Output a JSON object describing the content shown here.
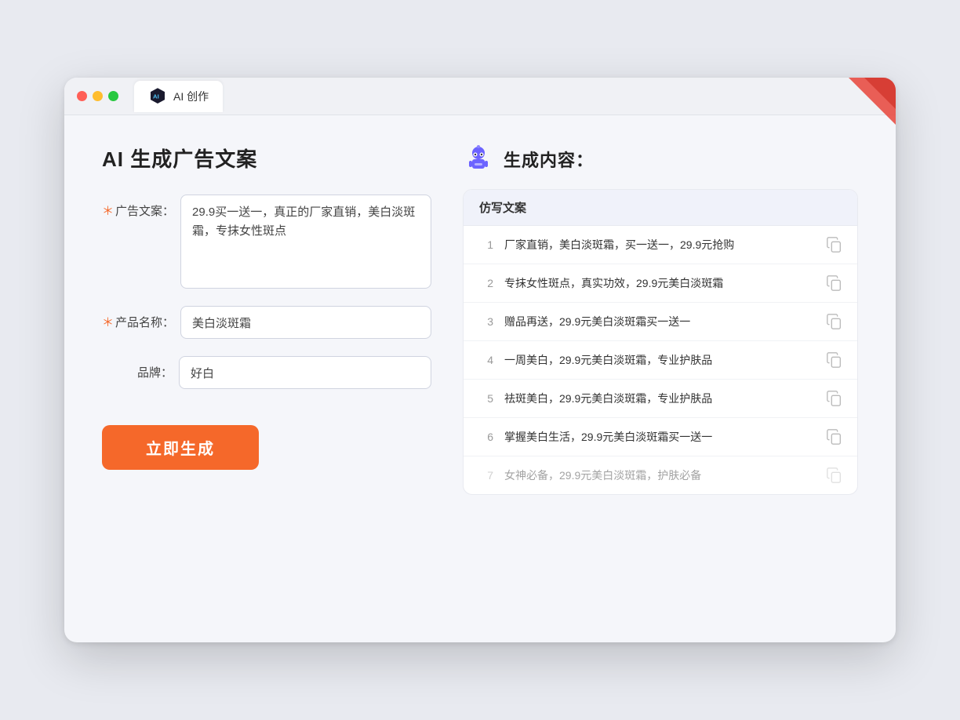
{
  "window": {
    "tab_label": "AI 创作"
  },
  "page": {
    "title": "AI 生成广告文案",
    "result_title": "生成内容："
  },
  "form": {
    "ad_copy_label": "广告文案：",
    "ad_copy_required": "＊",
    "ad_copy_value": "29.9买一送一，真正的厂家直销，美白淡斑霜，专抹女性斑点",
    "product_name_label": "产品名称：",
    "product_name_required": "＊",
    "product_name_value": "美白淡斑霜",
    "brand_label": "品牌：",
    "brand_value": "好白",
    "generate_btn_label": "立即生成"
  },
  "results": {
    "table_header": "仿写文案",
    "rows": [
      {
        "num": "1",
        "text": "厂家直销，美白淡斑霜，买一送一，29.9元抢购",
        "faded": false
      },
      {
        "num": "2",
        "text": "专抹女性斑点，真实功效，29.9元美白淡斑霜",
        "faded": false
      },
      {
        "num": "3",
        "text": "赠品再送，29.9元美白淡斑霜买一送一",
        "faded": false
      },
      {
        "num": "4",
        "text": "一周美白，29.9元美白淡斑霜，专业护肤品",
        "faded": false
      },
      {
        "num": "5",
        "text": "祛斑美白，29.9元美白淡斑霜，专业护肤品",
        "faded": false
      },
      {
        "num": "6",
        "text": "掌握美白生活，29.9元美白淡斑霜买一送一",
        "faded": false
      },
      {
        "num": "7",
        "text": "女神必备，29.9元美白淡斑霜，护肤必备",
        "faded": true
      }
    ]
  }
}
